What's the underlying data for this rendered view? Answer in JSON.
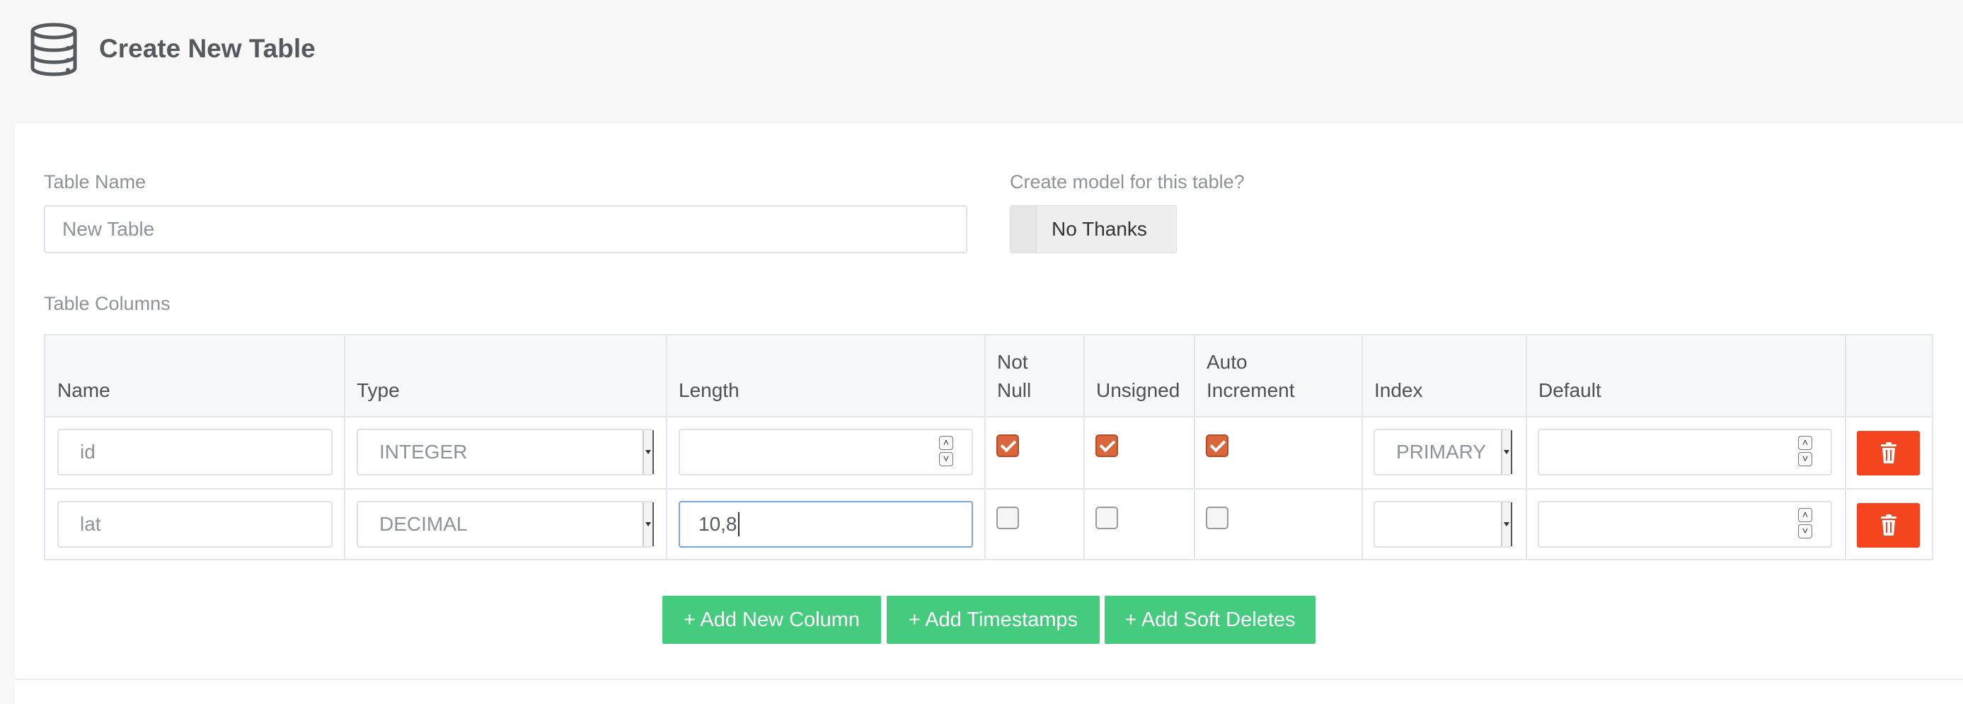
{
  "header": {
    "title": "Create New Table",
    "icon": "database-icon"
  },
  "form": {
    "table_name_label": "Table Name",
    "table_name_placeholder": "New Table",
    "model_label": "Create model for this table?",
    "model_toggle_label": "No Thanks",
    "columns_label": "Table Columns"
  },
  "table": {
    "headers": {
      "name": "Name",
      "type": "Type",
      "length": "Length",
      "not_null_1": "Not",
      "not_null_2": "Null",
      "unsigned": "Unsigned",
      "auto_inc_1": "Auto",
      "auto_inc_2": "Increment",
      "index": "Index",
      "default": "Default"
    },
    "rows": [
      {
        "name": "id",
        "type": "INTEGER",
        "length": "",
        "not_null": true,
        "unsigned": true,
        "auto_increment": true,
        "index": "PRIMARY",
        "default": ""
      },
      {
        "name": "lat",
        "type": "DECIMAL",
        "length": "10,8",
        "not_null": false,
        "unsigned": false,
        "auto_increment": false,
        "index": "",
        "default": ""
      }
    ]
  },
  "actions": {
    "add_column": "+ Add New Column",
    "add_timestamps": "+ Add Timestamps",
    "add_soft_deletes": "+ Add Soft Deletes"
  },
  "colors": {
    "accent_green": "#44cb7d",
    "delete_red": "#f4451e",
    "checkbox_orange": "#d9673b"
  }
}
